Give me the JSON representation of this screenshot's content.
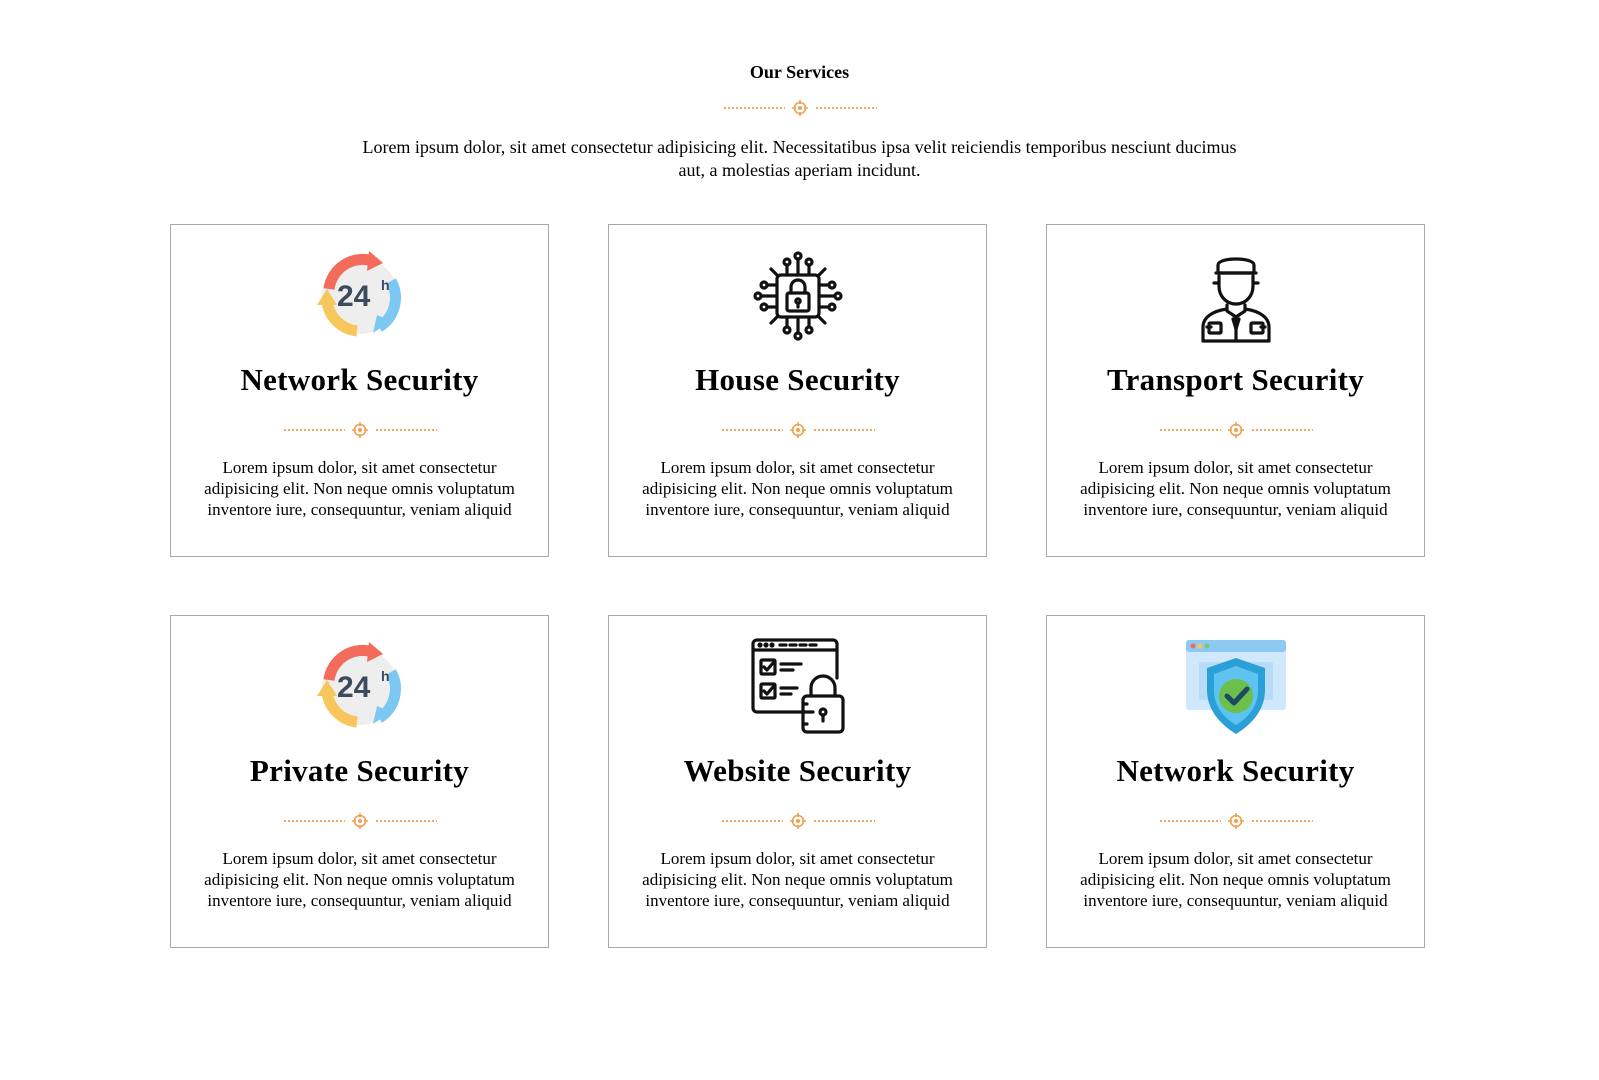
{
  "section": {
    "title": "Our Services",
    "description": "Lorem ipsum dolor, sit amet consectetur adipisicing elit. Necessitatibus ipsa velit reiciendis temporibus nesciunt ducimus aut, a molestias aperiam incidunt."
  },
  "colors": {
    "accent": "#f0a050",
    "border": "#a8a8a8"
  },
  "cards": [
    {
      "icon": "24h-clock-icon",
      "title": "Network Security",
      "text": "Lorem ipsum dolor, sit amet consectetur adipisicing elit. Non neque omnis voluptatum inventore iure, consequuntur, veniam aliquid"
    },
    {
      "icon": "cyber-lock-chip-icon",
      "title": "House Security",
      "text": "Lorem ipsum dolor, sit amet consectetur adipisicing elit. Non neque omnis voluptatum inventore iure, consequuntur, veniam aliquid"
    },
    {
      "icon": "security-guard-icon",
      "title": "Transport Security",
      "text": "Lorem ipsum dolor, sit amet consectetur adipisicing elit. Non neque omnis voluptatum inventore iure, consequuntur, veniam aliquid"
    },
    {
      "icon": "24h-clock-icon",
      "title": "Private Security",
      "text": "Lorem ipsum dolor, sit amet consectetur adipisicing elit. Non neque omnis voluptatum inventore iure, consequuntur, veniam aliquid"
    },
    {
      "icon": "website-lock-checklist-icon",
      "title": "Website Security",
      "text": "Lorem ipsum dolor, sit amet consectetur adipisicing elit. Non neque omnis voluptatum inventore iure, consequuntur, veniam aliquid"
    },
    {
      "icon": "browser-shield-check-icon",
      "title": "Network Security",
      "text": "Lorem ipsum dolor, sit amet consectetur adipisicing elit. Non neque omnis voluptatum inventore iure, consequuntur, veniam aliquid"
    }
  ]
}
